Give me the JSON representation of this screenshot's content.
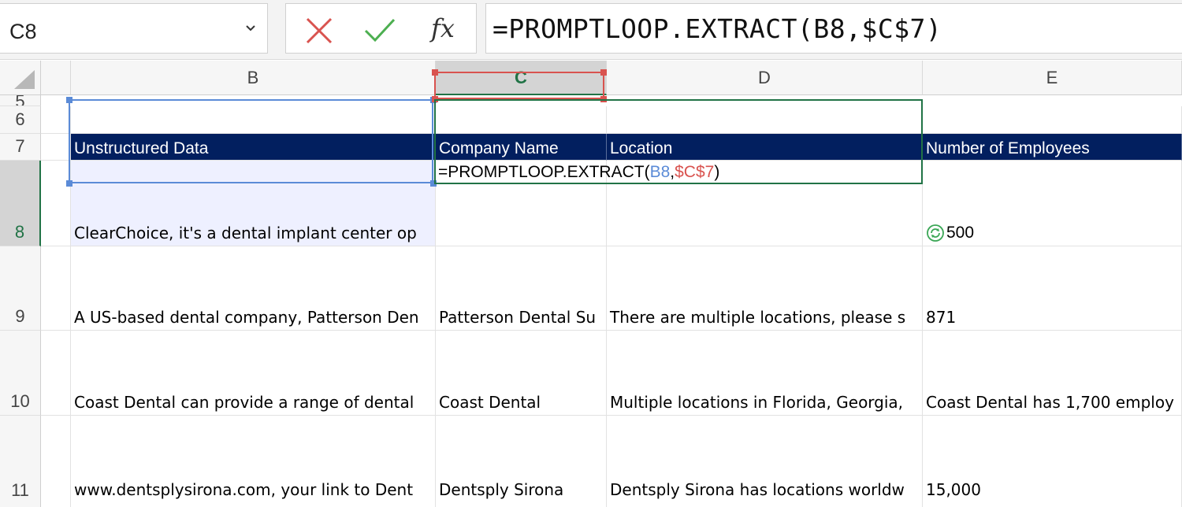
{
  "formula_bar": {
    "name_box": "C8",
    "formula": "=PROMPTLOOP.EXTRACT(B8,$C$7)",
    "fx_label": "fx"
  },
  "columns": [
    {
      "letter": "B"
    },
    {
      "letter": "C"
    },
    {
      "letter": "D"
    },
    {
      "letter": "E"
    }
  ],
  "rows": {
    "r5": "5",
    "r6": "6",
    "r7": "7",
    "r8": "8",
    "r9": "9",
    "r10": "10",
    "r11": "11"
  },
  "headers": {
    "b": "Unstructured Data",
    "c": "Company Name",
    "d": "Location",
    "e": "Number of Employees"
  },
  "cells": {
    "b8": "ClearChoice, it's a dental implant center op",
    "c8_formula_prefix": "=PROMPTLOOP.EXTRACT(",
    "c8_ref1": "B8",
    "c8_comma": ",",
    "c8_ref2": "$C$7",
    "c8_close": ")",
    "e8": "500",
    "b9": "A US-based dental company, Patterson Den",
    "c9": "Patterson Dental Su",
    "d9": "There are multiple locations, please s",
    "e9": "871",
    "b10": "Coast Dental can provide a range of dental",
    "c10": "Coast Dental",
    "d10": "Multiple locations in Florida, Georgia,",
    "e10": "Coast Dental has 1,700 employ",
    "b11": "www.dentsplysirona.com, your link to Dent",
    "c11": "Dentsply Sirona",
    "d11": "Dentsply Sirona has locations worldw",
    "e11": "15,000"
  },
  "colors": {
    "header_bg": "#021f5f",
    "excel_green": "#217346",
    "ref_blue": "#5b8bd7",
    "ref_red": "#d9534f"
  }
}
